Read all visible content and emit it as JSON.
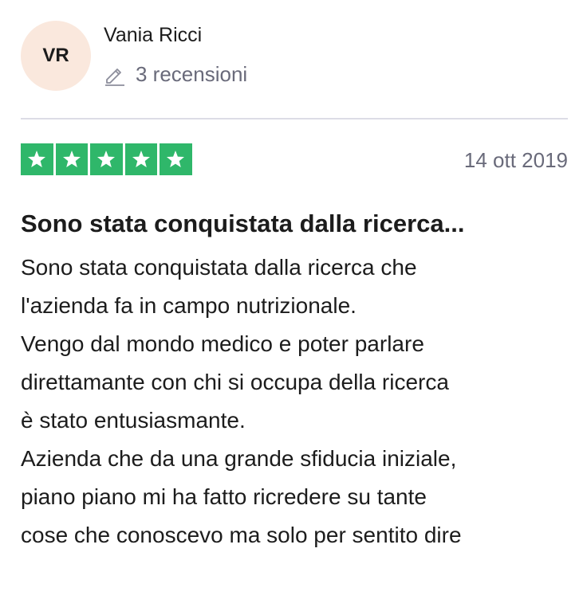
{
  "reviewer": {
    "initials": "VR",
    "name": "Vania Ricci",
    "reviews_count": "3 recensioni",
    "avatar_color": "#fae8dd"
  },
  "review": {
    "rating": 5,
    "rating_max": 5,
    "star_color": "#2fb76a",
    "date": "14 ott 2019",
    "title": "Sono stata conquistata dalla ricerca...",
    "body_lines": [
      "Sono stata conquistata dalla ricerca che",
      "l'azienda fa in campo nutrizionale.",
      "Vengo dal mondo medico e poter parlare",
      "direttamante con chi si occupa della ricerca",
      "è stato entusiasmante.",
      "Azienda che da una grande sfiducia iniziale,",
      "piano piano mi ha fatto ricredere su tante",
      "cose che conoscevo ma solo per sentito dire"
    ]
  },
  "icons": {
    "reviews_icon": "pencil-icon",
    "star_icon": "star-icon"
  }
}
